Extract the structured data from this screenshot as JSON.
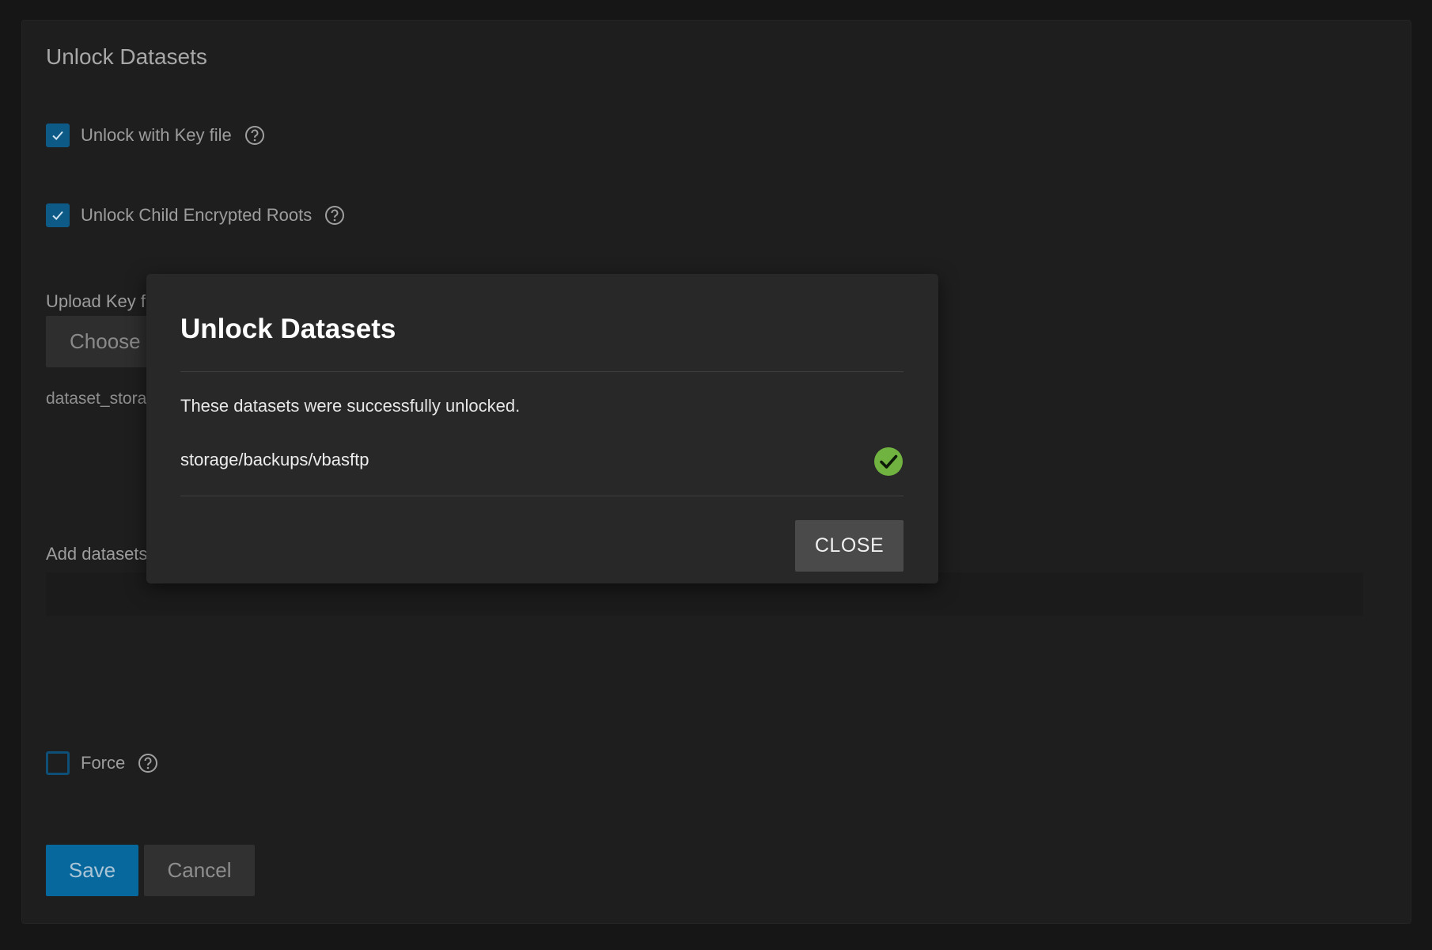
{
  "form": {
    "title": "Unlock Datasets",
    "unlock_with_key_file": {
      "label": "Unlock with Key file",
      "checked": true
    },
    "unlock_child_encrypted_roots": {
      "label": "Unlock Child Encrypted Roots",
      "checked": true
    },
    "upload_key_file_label": "Upload Key fi",
    "choose_button_label": "Choose",
    "selected_filename": "dataset_stora",
    "add_datasets_label": "Add datasets",
    "force": {
      "label": "Force",
      "checked": false
    },
    "save_label": "Save",
    "cancel_label": "Cancel"
  },
  "dialog": {
    "title": "Unlock Datasets",
    "message": "These datasets were successfully unlocked.",
    "datasets": [
      {
        "name": "storage/backups/vbasftp",
        "status": "success-icon"
      }
    ],
    "close_label": "CLOSE"
  },
  "colors": {
    "page_background": "#161616",
    "card_background": "#1e1e1e",
    "dialog_background": "#282828",
    "primary_button": "#07689e",
    "checkbox_checked": "#0e5a86",
    "success_green": "#71b340"
  }
}
